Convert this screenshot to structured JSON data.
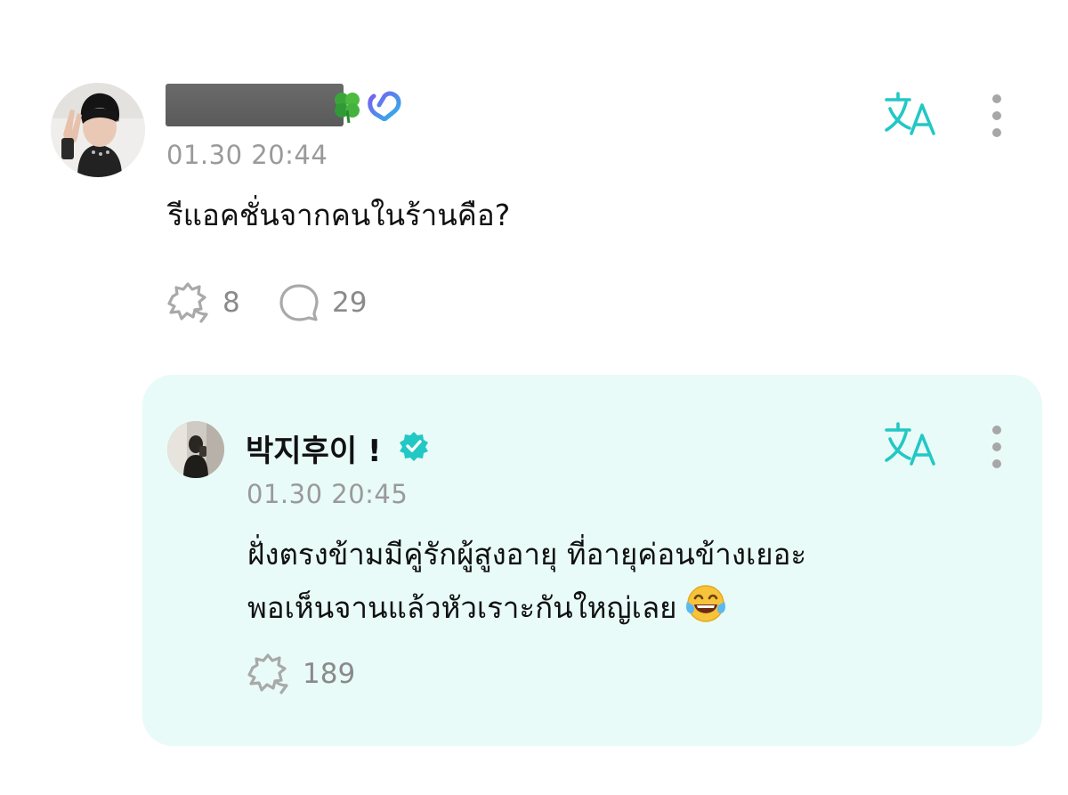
{
  "post": {
    "timestamp": "01.30 20:44",
    "text": "รีแอคชั่นจากคนในร้านคือ?",
    "reactions": "8",
    "comments": "29",
    "icons": {
      "badge": "clover-icon",
      "membership": "membership-heart-icon",
      "translate": "translate-icon",
      "more": "kebab-menu-icon",
      "react": "reaction-icon",
      "comment": "comment-icon"
    }
  },
  "reply": {
    "author": "박지후이 !",
    "timestamp": "01.30 20:45",
    "lines": [
      "ฝั่งตรงข้ามมีคู่รักผู้สูงอายุ ที่อายุค่อนข้างเยอะ",
      "พอเห็นจานแล้วหัวเราะกันใหญ่เลย"
    ],
    "emoji": "face-with-tears-of-joy",
    "reactions": "189",
    "icons": {
      "verified": "verified-badge-icon",
      "translate": "translate-icon",
      "more": "kebab-menu-icon",
      "react": "reaction-icon"
    }
  },
  "colors": {
    "accent": "#22c8c4",
    "reply_background": "#e8fbf8",
    "muted_text": "#9a9a9a",
    "icon_gray": "#a7a7a7"
  }
}
